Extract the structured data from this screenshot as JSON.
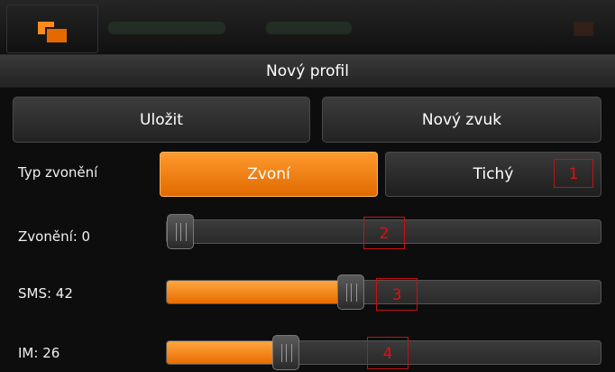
{
  "header": {
    "title": "Nový profil"
  },
  "actions": {
    "save_label": "Uložit",
    "new_sound_label": "Nový zvuk"
  },
  "ring_type": {
    "label": "Typ zvonění",
    "options": [
      "Zvoní",
      "Tichý"
    ],
    "selected": "Zvoní"
  },
  "sliders": [
    {
      "label": "Zvonění: 0",
      "value": 0,
      "max": 100
    },
    {
      "label": "SMS: 42",
      "value": 42,
      "max": 100
    },
    {
      "label": "IM: 26",
      "value": 26,
      "max": 100
    }
  ],
  "markers": [
    "1",
    "2",
    "3",
    "4"
  ],
  "colors": {
    "accent": "#ff8c1a",
    "background": "#0d0d0d",
    "marker": "#e01010"
  },
  "icons": {
    "app": "windows-stack-icon",
    "close": "close-icon"
  }
}
